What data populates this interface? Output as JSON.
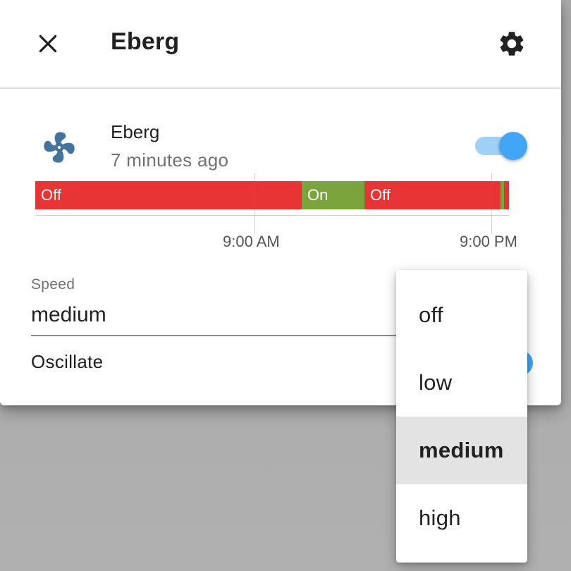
{
  "dialog": {
    "title": "Eberg"
  },
  "entity": {
    "name": "Eberg",
    "last_changed": "7 minutes ago",
    "icon": "fan-icon",
    "state_on": true
  },
  "history": {
    "segments": [
      {
        "label": "Off",
        "state": "off"
      },
      {
        "label": "On",
        "state": "on"
      },
      {
        "label": "Off",
        "state": "off"
      },
      {
        "label": "",
        "state": "on"
      },
      {
        "label": "",
        "state": "off"
      }
    ],
    "ticks": [
      "9:00 AM",
      "9:00 PM"
    ],
    "colors": {
      "off": "#e83435",
      "on": "#7aa53c"
    }
  },
  "speed": {
    "label": "Speed",
    "value": "medium"
  },
  "oscillate": {
    "label": "Oscillate",
    "state_on": true
  },
  "speed_menu": {
    "options": [
      {
        "label": "off",
        "selected": false
      },
      {
        "label": "low",
        "selected": false
      },
      {
        "label": "medium",
        "selected": true
      },
      {
        "label": "high",
        "selected": false
      }
    ]
  },
  "colors": {
    "accent": "#42a5f5",
    "icon": "#44739e"
  }
}
